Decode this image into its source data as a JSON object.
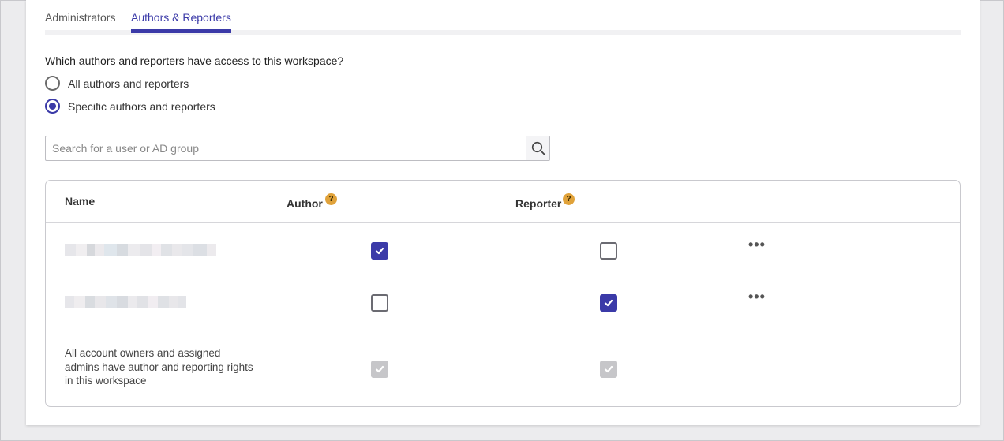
{
  "tabs": [
    {
      "label": "Administrators",
      "active": false
    },
    {
      "label": "Authors & Reporters",
      "active": true
    }
  ],
  "access": {
    "question": "Which authors and reporters have access to this workspace?",
    "options": [
      {
        "label": "All authors and reporters",
        "selected": false
      },
      {
        "label": "Specific authors and reporters",
        "selected": true
      }
    ]
  },
  "search": {
    "placeholder": "Search for a user or AD group",
    "value": "",
    "icon": "search-icon"
  },
  "table": {
    "headers": {
      "name": "Name",
      "author": "Author",
      "reporter": "Reporter",
      "help": "?"
    },
    "rows": [
      {
        "name": "[redacted]",
        "author": true,
        "reporter": false,
        "actions": "•••"
      },
      {
        "name": "[redacted]",
        "author": false,
        "reporter": true,
        "actions": "•••"
      }
    ],
    "footer_note": "All account owners and assigned admins have author and reporting rights in this workspace",
    "footer_author": true,
    "footer_reporter": true
  },
  "colors": {
    "accent": "#3b3aa8",
    "help_badge": "#e0a23a",
    "disabled_check": "#c6c6c9"
  }
}
